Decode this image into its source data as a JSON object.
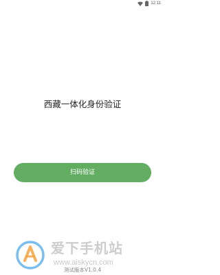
{
  "status_bar": {
    "time": "12:11",
    "icons": [
      "wifi-icon",
      "battery-icon"
    ]
  },
  "main": {
    "title": "西藏一体化身份验证",
    "scan_button_label": "扫码验证"
  },
  "watermark": {
    "site_name": "爱下手机站",
    "url": "www.aiskycn.com"
  },
  "footer": {
    "version": "测试版本V1.0.4"
  },
  "colors": {
    "button_green": "#63ad63",
    "watermark_blue": "#3aa0e8",
    "watermark_orange": "#f39a2a"
  }
}
